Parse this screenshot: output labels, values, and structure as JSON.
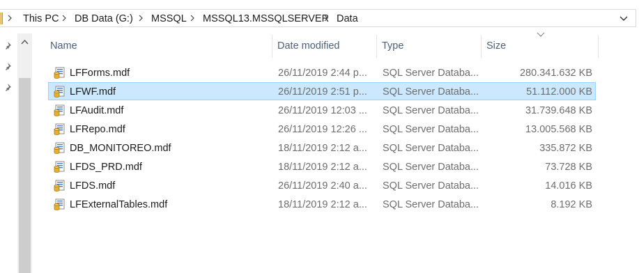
{
  "breadcrumb": [
    "This PC",
    "DB Data (G:)",
    "MSSQL",
    "MSSQL13.MSSQLSERVER",
    "Data"
  ],
  "separator_icon": "chevron-right-icon",
  "columns": {
    "name": "Name",
    "date": "Date modified",
    "type": "Type",
    "size": "Size"
  },
  "sort": {
    "column": "size",
    "direction": "descending"
  },
  "files": [
    {
      "name": "LFForms.mdf",
      "date": "26/11/2019 2:44 p...",
      "type": "SQL Server Databa...",
      "size": "280.341.632 KB",
      "selected": false
    },
    {
      "name": "LFWF.mdf",
      "date": "26/11/2019 2:51 p...",
      "type": "SQL Server Databa...",
      "size": "51.112.000 KB",
      "selected": true
    },
    {
      "name": "LFAudit.mdf",
      "date": "26/11/2019 12:03 ...",
      "type": "SQL Server Databa...",
      "size": "31.739.648 KB",
      "selected": false
    },
    {
      "name": "LFRepo.mdf",
      "date": "26/11/2019 12:26 ...",
      "type": "SQL Server Databa...",
      "size": "13.005.568 KB",
      "selected": false
    },
    {
      "name": "DB_MONITOREO.mdf",
      "date": "18/11/2019 2:12 a...",
      "type": "SQL Server Databa...",
      "size": "335.872 KB",
      "selected": false
    },
    {
      "name": "LFDS_PRD.mdf",
      "date": "18/11/2019 2:12 a...",
      "type": "SQL Server Databa...",
      "size": "73.728 KB",
      "selected": false
    },
    {
      "name": "LFDS.mdf",
      "date": "26/11/2019 2:40 a...",
      "type": "SQL Server Databa...",
      "size": "14.016 KB",
      "selected": false
    },
    {
      "name": "LFExternalTables.mdf",
      "date": "18/11/2019 2:12 a...",
      "type": "SQL Server Databa...",
      "size": "8.192 KB",
      "selected": false
    }
  ],
  "colors": {
    "selection_bg": "#cce8ff",
    "selection_border": "#99d1ff",
    "header_text": "#4c607a",
    "secondary_text": "#6d6d6d"
  }
}
